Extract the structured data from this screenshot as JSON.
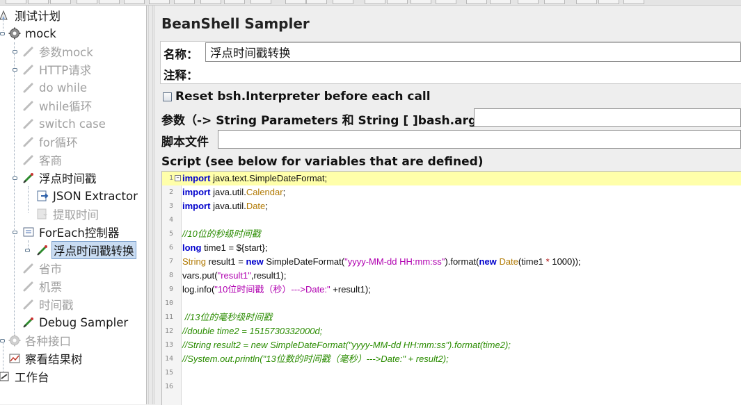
{
  "tree": {
    "items": [
      {
        "label": "测试计划",
        "icon": "test-plan-icon",
        "state": "enabled"
      },
      {
        "label": "mock",
        "icon": "thread-group-gear-icon",
        "state": "enabled"
      },
      {
        "label": "参数mock",
        "icon": "sampler-pencil-icon",
        "state": "disabled"
      },
      {
        "label": "HTTP请求",
        "icon": "sampler-pencil-icon",
        "state": "disabled"
      },
      {
        "label": "do while",
        "icon": "sampler-pencil-icon",
        "state": "disabled"
      },
      {
        "label": "while循环",
        "icon": "sampler-pencil-icon",
        "state": "disabled"
      },
      {
        "label": "switch case",
        "icon": "sampler-pencil-icon",
        "state": "disabled"
      },
      {
        "label": "for循环",
        "icon": "sampler-pencil-icon",
        "state": "disabled"
      },
      {
        "label": "客商",
        "icon": "sampler-pencil-icon",
        "state": "disabled"
      },
      {
        "label": "浮点时间戳",
        "icon": "sampler-pencil-icon",
        "state": "enabled"
      },
      {
        "label": "JSON Extractor",
        "icon": "post-processor-icon",
        "state": "enabled"
      },
      {
        "label": "提取时间",
        "icon": "post-processor-icon",
        "state": "disabled"
      },
      {
        "label": "ForEach控制器",
        "icon": "controller-icon",
        "state": "enabled"
      },
      {
        "label": "浮点时间戳转换",
        "icon": "sampler-pencil-icon",
        "state": "selected"
      },
      {
        "label": "省市",
        "icon": "sampler-pencil-icon",
        "state": "disabled"
      },
      {
        "label": "机票",
        "icon": "sampler-pencil-icon",
        "state": "disabled"
      },
      {
        "label": "时间戳",
        "icon": "sampler-pencil-icon",
        "state": "disabled"
      },
      {
        "label": "Debug Sampler",
        "icon": "sampler-pencil-icon",
        "state": "enabled"
      },
      {
        "label": "各种接口",
        "icon": "thread-group-gear-icon",
        "state": "disabled"
      },
      {
        "label": "察看结果树",
        "icon": "listener-graph-icon",
        "state": "enabled"
      },
      {
        "label": "工作台",
        "icon": "workbench-icon",
        "state": "enabled"
      }
    ]
  },
  "panel": {
    "title": "BeanShell Sampler",
    "name_label": "名称：",
    "name_value": "浮点时间戳转换",
    "comment_label": "注释：",
    "reset_label": "Reset bsh.Interpreter before each call",
    "params_label": "参数（-> String Parameters 和 String [ ]bash.args）",
    "file_label": "脚本文件",
    "script_label": "Script (see below for variables that are defined)"
  },
  "editor": {
    "current_line": 1,
    "lines": [
      {
        "n": "1",
        "text": "import java.text.SimpleDateFormat;"
      },
      {
        "n": "2",
        "text": "import java.util.Calendar;"
      },
      {
        "n": "3",
        "text": "import java.util.Date;"
      },
      {
        "n": "4",
        "text": ""
      },
      {
        "n": "5",
        "text": "//10位的秒级时间戳"
      },
      {
        "n": "6",
        "text": "long time1 = ${start};"
      },
      {
        "n": "7",
        "text": "String result1 = new SimpleDateFormat(\"yyyy-MM-dd HH:mm:ss\").format(new Date(time1 * 1000));"
      },
      {
        "n": "8",
        "text": "vars.put(\"result1\",result1);"
      },
      {
        "n": "9",
        "text": "log.info(\"10位时间戳（秒）--->Date:\" +result1);"
      },
      {
        "n": "10",
        "text": ""
      },
      {
        "n": "11",
        "text": " //13位的毫秒级时间戳"
      },
      {
        "n": "12",
        "text": "//double time2 = 1515730332000d;"
      },
      {
        "n": "13",
        "text": "//String result2 = new SimpleDateFormat(\"yyyy-MM-dd HH:mm:ss\").format(time2);"
      },
      {
        "n": "14",
        "text": "//System.out.println(\"13位数的时间戳（毫秒）--->Date:\" + result2);"
      },
      {
        "n": "15",
        "text": ""
      },
      {
        "n": "16",
        "text": ""
      }
    ]
  },
  "colors": {
    "keyword": "#0000cc",
    "type": "#b07800",
    "string": "#b000b0",
    "comment": "#2a8c00",
    "current_line": "#ffffaa",
    "selection": "#c9dcf2"
  }
}
